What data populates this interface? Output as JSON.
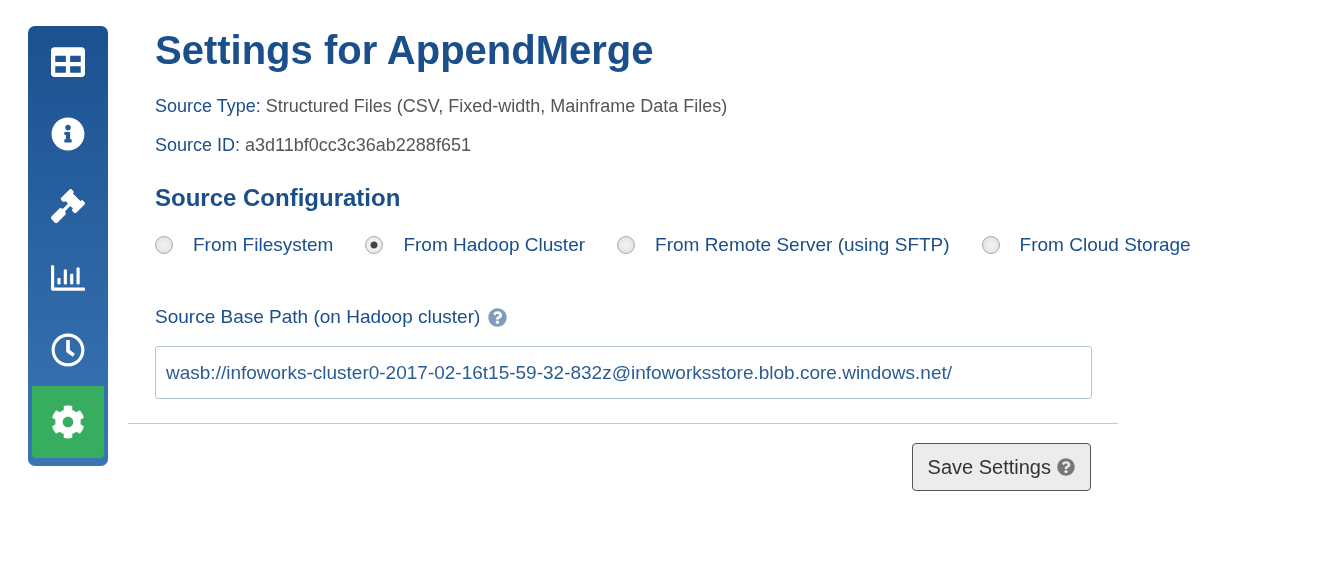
{
  "sidebar": {
    "items": [
      {
        "selected": false
      },
      {
        "selected": false
      },
      {
        "selected": false
      },
      {
        "selected": false
      },
      {
        "selected": false
      },
      {
        "selected": true
      }
    ]
  },
  "title": "Settings for AppendMerge",
  "info": [
    {
      "label": "Source Type:",
      "value": "Structured Files (CSV, Fixed-width, Mainframe Data Files)"
    },
    {
      "label": "Source ID:",
      "value": "a3d11bf0cc3c36ab2288f651"
    }
  ],
  "section_title": "Source Configuration",
  "source_options": [
    {
      "label": "From Filesystem",
      "selected": false
    },
    {
      "label": "From Hadoop Cluster",
      "selected": true
    },
    {
      "label": "From Remote Server (using SFTP)",
      "selected": false
    },
    {
      "label": "From Cloud Storage",
      "selected": false
    }
  ],
  "base_path": {
    "label": "Source Base Path (on Hadoop cluster)",
    "value": "wasb://infoworks-cluster0-2017-02-16t15-59-32-832z@infoworksstore.blob.core.windows.net/"
  },
  "save_button": "Save Settings"
}
